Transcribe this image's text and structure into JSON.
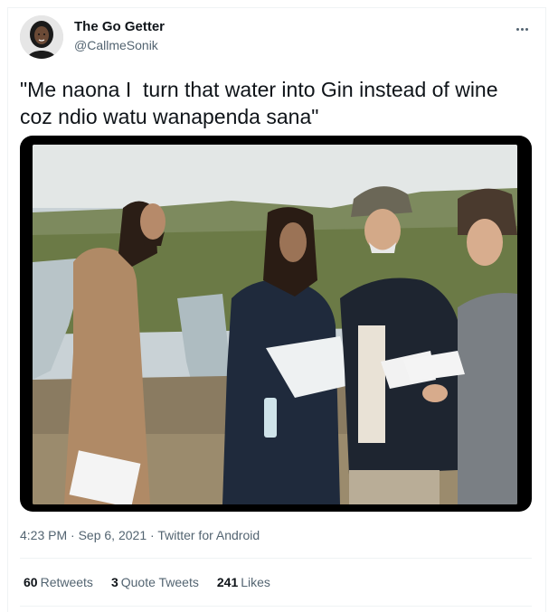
{
  "author": {
    "name": "The Go Getter",
    "handle": "@CallmeSonik"
  },
  "tweet": {
    "text": "\"Me naona I  turn that water into Gin instead of wine coz ndio watu wanapenda sana\""
  },
  "meta": {
    "time": "4:23 PM",
    "date": "Sep 6, 2021",
    "source": "Twitter for Android",
    "separator": "·"
  },
  "stats": {
    "retweets_count": "60",
    "retweets_label": "Retweets",
    "quotes_count": "3",
    "quotes_label": "Quote Tweets",
    "likes_count": "241",
    "likes_label": "Likes"
  },
  "icons": {
    "more": "more-horizontal-icon"
  }
}
